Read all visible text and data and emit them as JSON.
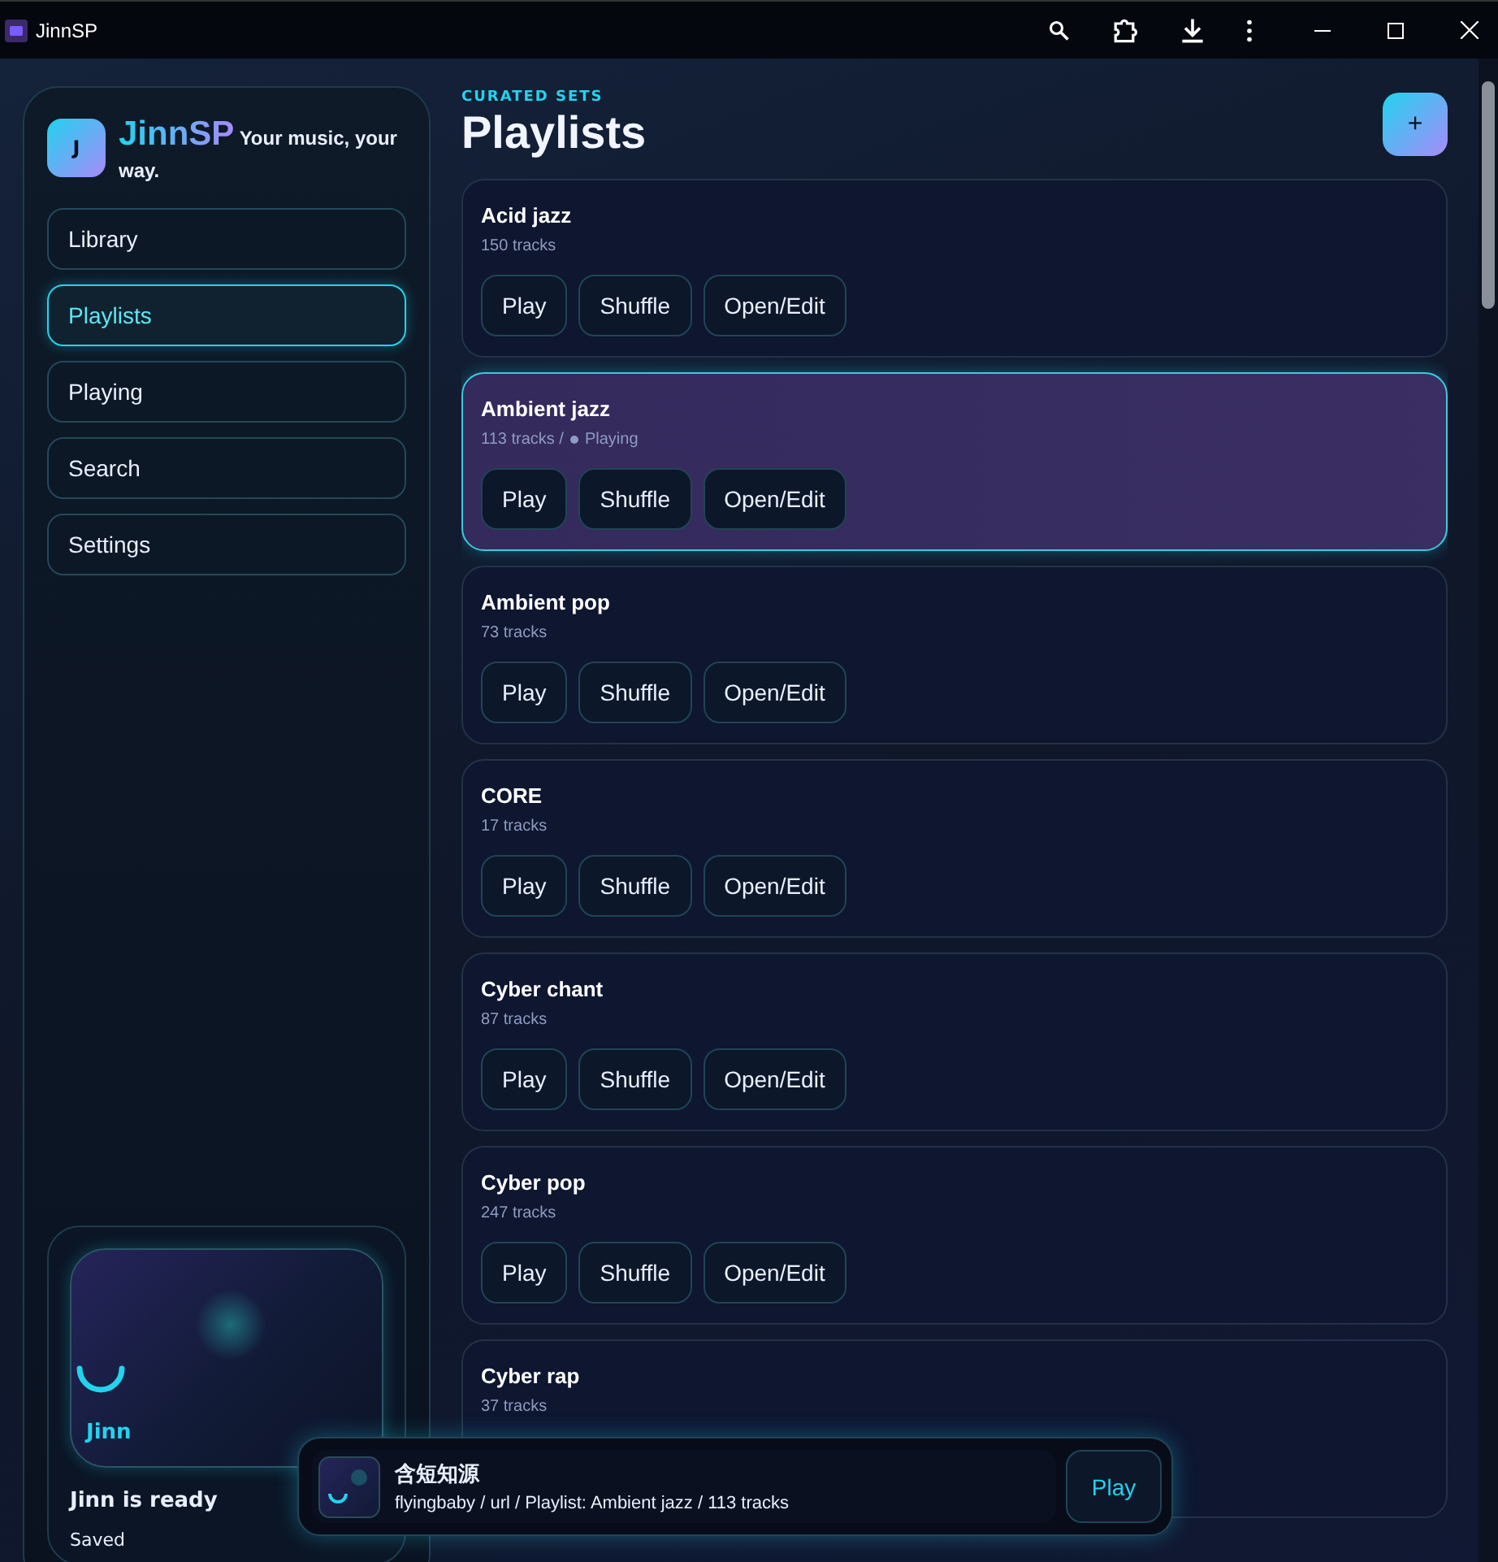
{
  "window": {
    "title": "JinnSP"
  },
  "brand": {
    "initial": "J",
    "name": "JinnSP",
    "tagline": "Your music, your way."
  },
  "nav": [
    {
      "label": "Library",
      "selected": false
    },
    {
      "label": "Playlists",
      "selected": true
    },
    {
      "label": "Playing",
      "selected": false
    },
    {
      "label": "Search",
      "selected": false
    },
    {
      "label": "Settings",
      "selected": false
    }
  ],
  "assistant": {
    "name": "Jinn",
    "status": "Jinn is ready",
    "note": "Saved"
  },
  "header": {
    "eyebrow": "CURATED SETS",
    "title": "Playlists",
    "add_button": "+"
  },
  "playlists": [
    {
      "name": "Acid jazz",
      "tracks": "150 tracks",
      "playing": false,
      "selected": false,
      "actions": [
        "Play",
        "Shuffle",
        "Open/Edit"
      ]
    },
    {
      "name": "Ambient jazz",
      "tracks": "113 tracks /",
      "status": "Playing",
      "playing": true,
      "selected": true,
      "actions": [
        "Play",
        "Shuffle",
        "Open/Edit"
      ]
    },
    {
      "name": "Ambient pop",
      "tracks": "73 tracks",
      "playing": false,
      "selected": false,
      "actions": [
        "Play",
        "Shuffle",
        "Open/Edit"
      ]
    },
    {
      "name": "CORE",
      "tracks": "17 tracks",
      "playing": false,
      "selected": false,
      "actions": [
        "Play",
        "Shuffle",
        "Open/Edit"
      ]
    },
    {
      "name": "Cyber chant",
      "tracks": "87 tracks",
      "playing": false,
      "selected": false,
      "actions": [
        "Play",
        "Shuffle",
        "Open/Edit"
      ]
    },
    {
      "name": "Cyber pop",
      "tracks": "247 tracks",
      "playing": false,
      "selected": false,
      "actions": [
        "Play",
        "Shuffle",
        "Open/Edit"
      ]
    },
    {
      "name": "Cyber rap",
      "tracks": "37 tracks",
      "playing": false,
      "selected": false
    }
  ],
  "player": {
    "title": "含短知源",
    "subtitle": "flyingbaby / url / Playlist: Ambient jazz / 113 tracks",
    "button": "Play"
  }
}
